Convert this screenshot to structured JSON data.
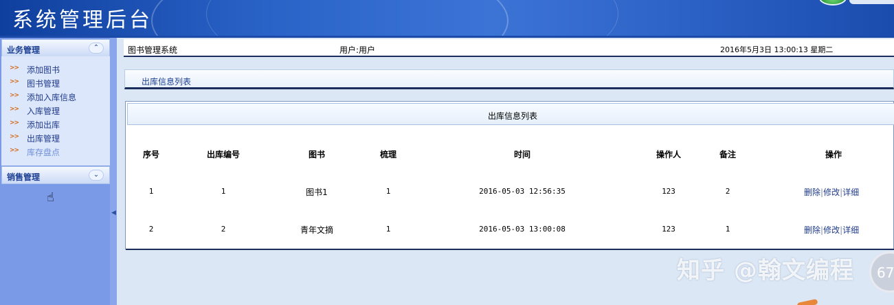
{
  "header": {
    "title": "系统管理后台"
  },
  "sidebar": {
    "section1": {
      "label": "业务管理",
      "toggle_icon": "collapse-up-icon"
    },
    "items": [
      {
        "label": "添加图书"
      },
      {
        "label": "图书管理"
      },
      {
        "label": "添加入库信息"
      },
      {
        "label": "入库管理"
      },
      {
        "label": "添加出库"
      },
      {
        "label": "出库管理"
      },
      {
        "label": "库存盘点"
      }
    ],
    "bullet": ">>",
    "section2": {
      "label": "销售管理",
      "toggle_icon": "expand-down-icon"
    }
  },
  "topbar": {
    "system_name": "图书管理系统",
    "user": "用户:用户",
    "datetime": "2016年5月3日 13:00:13 星期二"
  },
  "page": {
    "title": "出库信息列表"
  },
  "table": {
    "caption": "出库信息列表",
    "columns": [
      "序号",
      "出库编号",
      "图书",
      "梳理",
      "时间",
      "操作人",
      "备注",
      "操作"
    ],
    "rows": [
      {
        "no": "1",
        "code": "1",
        "book": "图书1",
        "qty": "1",
        "time": "2016-05-03 12:56:35",
        "operator": "123",
        "remark": "2"
      },
      {
        "no": "2",
        "code": "2",
        "book": "青年文摘",
        "qty": "1",
        "time": "2016-05-03 13:00:08",
        "operator": "123",
        "remark": "1"
      }
    ],
    "actions": {
      "delete": "删除",
      "edit": "修改",
      "detail": "详细",
      "separator": "|"
    }
  },
  "watermark": {
    "text": "知乎 @翰文编程",
    "badge": "67"
  },
  "colors": {
    "header_blue": "#2a63c7",
    "sidebar_blue": "#7a99e6",
    "link_blue": "#1f3b8c",
    "bullet_orange": "#d46a14"
  }
}
